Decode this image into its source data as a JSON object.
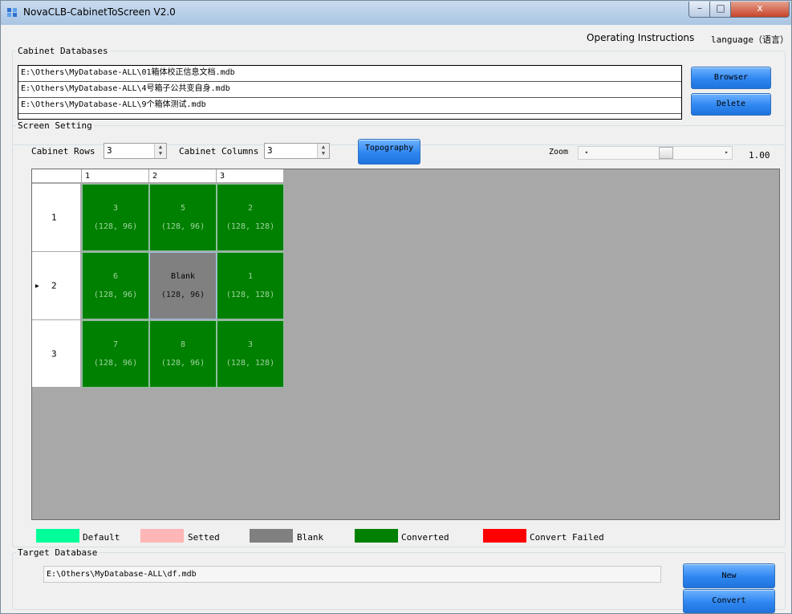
{
  "window": {
    "title": "NovaCLB-CabinetToScreen V2.0",
    "controls": {
      "minimize": "–",
      "maximize": "□",
      "close": "x"
    }
  },
  "menu": {
    "instructions": "Operating Instructions",
    "language": "language（语言）"
  },
  "cabinet_databases": {
    "legend": "Cabinet Databases",
    "items": [
      "E:\\Others\\MyDatabase-ALL\\01箱体校正信息文档.mdb",
      "E:\\Others\\MyDatabase-ALL\\4号箱子公共变自身.mdb",
      "E:\\Others\\MyDatabase-ALL\\9个箱体测试.mdb"
    ],
    "browser_label": "Browser",
    "delete_label": "Delete"
  },
  "screen_setting": {
    "legend": "Screen Setting",
    "rows_label": "Cabinet Rows",
    "rows_value": "3",
    "cols_label": "Cabinet Columns",
    "cols_value": "3",
    "topography_label": "Topography",
    "zoom_label": "Zoom",
    "zoom_value": "1.00"
  },
  "grid": {
    "col_headers": [
      "1",
      "2",
      "3"
    ],
    "row_headers": [
      "1",
      "2",
      "3"
    ],
    "current_row_marker": "▶",
    "current_row_index": 1,
    "rows": [
      [
        {
          "id": "3",
          "size": "(128, 96)",
          "status": "converted"
        },
        {
          "id": "5",
          "size": "(128, 96)",
          "status": "converted"
        },
        {
          "id": "2",
          "size": "(128, 128)",
          "status": "converted"
        }
      ],
      [
        {
          "id": "6",
          "size": "(128, 96)",
          "status": "converted"
        },
        {
          "id": "Blank",
          "size": "(128, 96)",
          "status": "blank"
        },
        {
          "id": "1",
          "size": "(128, 128)",
          "status": "converted"
        }
      ],
      [
        {
          "id": "7",
          "size": "(128, 96)",
          "status": "converted"
        },
        {
          "id": "8",
          "size": "(128, 96)",
          "status": "converted"
        },
        {
          "id": "3",
          "size": "(128, 128)",
          "status": "converted"
        }
      ]
    ]
  },
  "legend": [
    {
      "label": "Default",
      "color": "#00ff99"
    },
    {
      "label": "Setted",
      "color": "#ffb6b6"
    },
    {
      "label": "Blank",
      "color": "#808080"
    },
    {
      "label": "Converted",
      "color": "#008000"
    },
    {
      "label": "Convert Failed",
      "color": "#ff0000"
    }
  ],
  "target_database": {
    "legend": "Target Database",
    "path": "E:\\Others\\MyDatabase-ALL\\df.mdb",
    "new_label": "New",
    "convert_label": "Convert"
  }
}
